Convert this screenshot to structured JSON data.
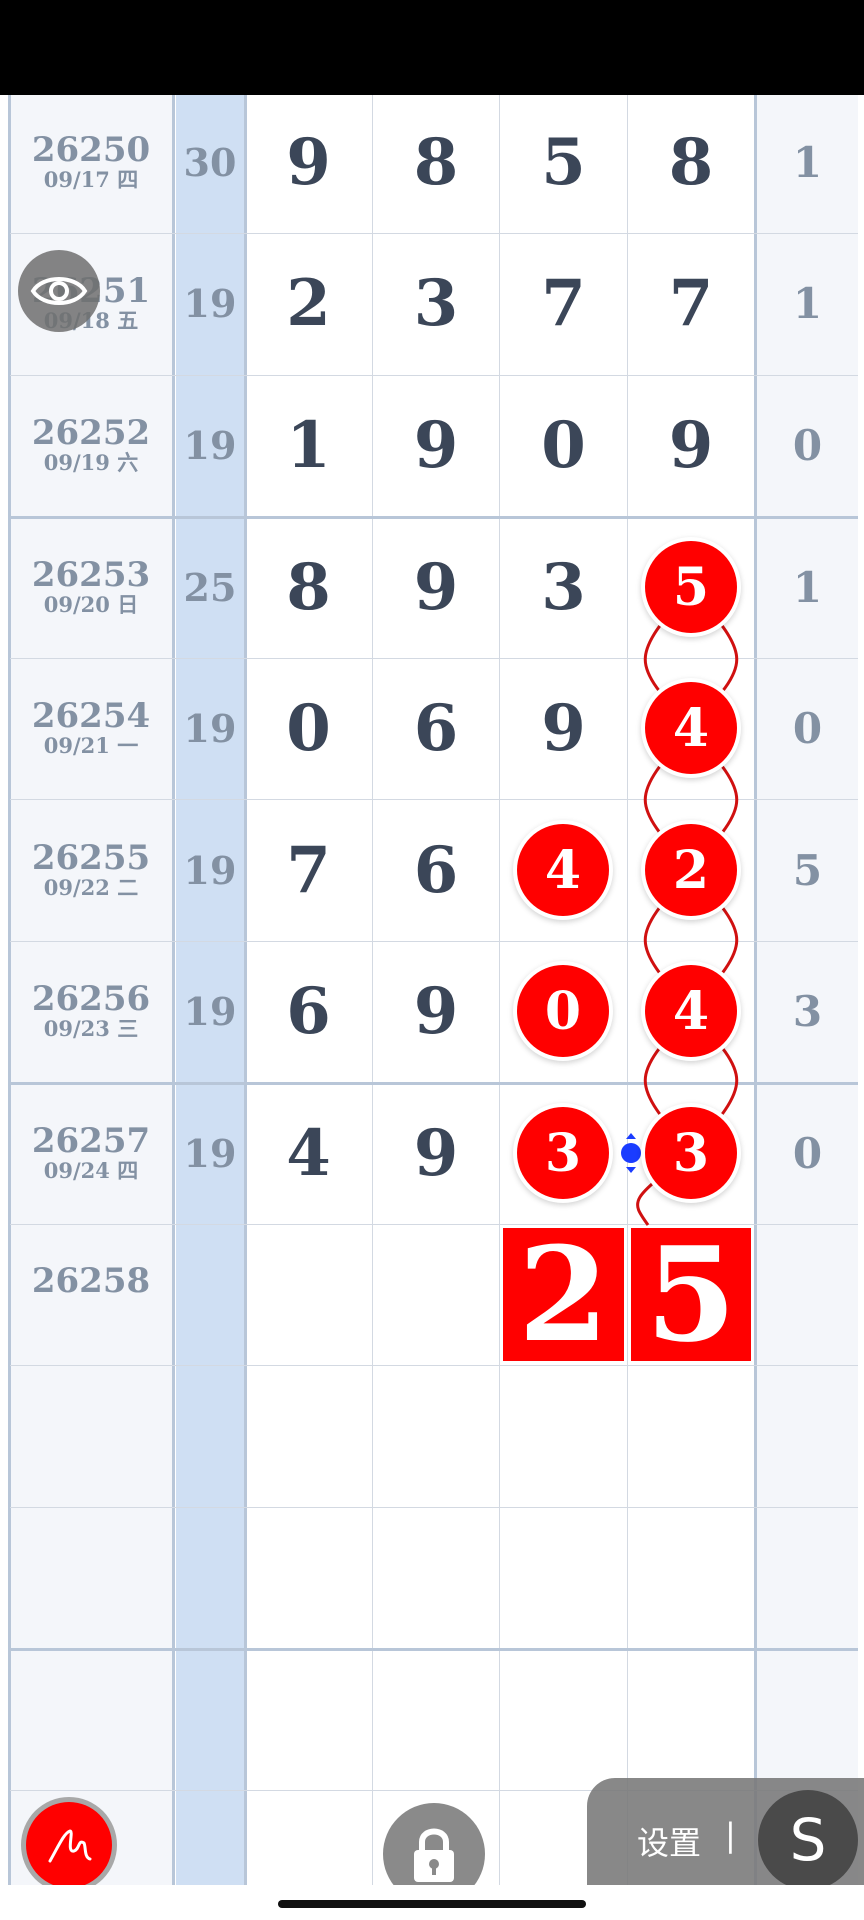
{
  "rows": [
    {
      "period": "26250",
      "date": "09/17 四",
      "sum": "30",
      "d1": "9",
      "d2": "8",
      "d3": "5",
      "d4": "8",
      "right": "1"
    },
    {
      "period": "26251",
      "date": "09/18 五",
      "sum": "19",
      "d1": "2",
      "d2": "3",
      "d3": "7",
      "d4": "7",
      "right": "1"
    },
    {
      "period": "26252",
      "date": "09/19 六",
      "sum": "19",
      "d1": "1",
      "d2": "9",
      "d3": "0",
      "d4": "9",
      "right": "0"
    },
    {
      "period": "26253",
      "date": "09/20 日",
      "sum": "25",
      "d1": "8",
      "d2": "9",
      "d3": "3",
      "d4": "5",
      "right": "1"
    },
    {
      "period": "26254",
      "date": "09/21 一",
      "sum": "19",
      "d1": "0",
      "d2": "6",
      "d3": "9",
      "d4": "4",
      "right": "0"
    },
    {
      "period": "26255",
      "date": "09/22 二",
      "sum": "19",
      "d1": "7",
      "d2": "6",
      "d3": "4",
      "d4": "2",
      "right": "5"
    },
    {
      "period": "26256",
      "date": "09/23 三",
      "sum": "19",
      "d1": "6",
      "d2": "9",
      "d3": "0",
      "d4": "4",
      "right": "3"
    },
    {
      "period": "26257",
      "date": "09/24 四",
      "sum": "19",
      "d1": "4",
      "d2": "9",
      "d3": "3",
      "d4": "3",
      "right": "0"
    },
    {
      "period": "26258"
    }
  ],
  "prediction": {
    "d3": "2",
    "d4": "5"
  },
  "settings_label": "设置",
  "settings_divider": "|",
  "s_button_label": "S",
  "icons": {
    "eye": "eye-icon",
    "pen": "pen-icon",
    "lock": "lock-icon"
  },
  "colors": {
    "ball": "#ff0000",
    "sum_column": "#cfdff3",
    "digit": "#3b4658",
    "muted": "#8391a3"
  }
}
